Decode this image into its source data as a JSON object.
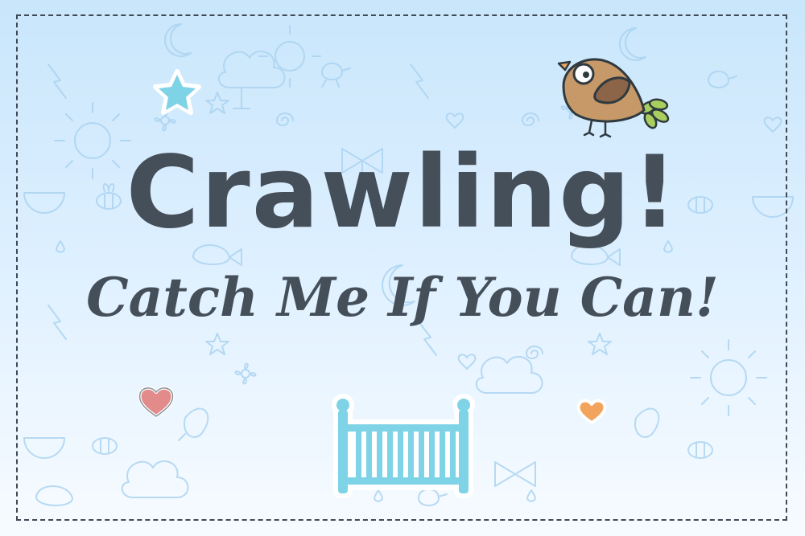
{
  "card": {
    "title": "Crawling!",
    "subtitle": "Catch Me If You Can!"
  },
  "colors": {
    "text": "#454f59",
    "background_top": "#c9e6fb",
    "background_bottom": "#f7fbff",
    "doodle_line": "#a9d2f0",
    "frame_dash": "#3f4a55",
    "crib": "#7fd3e6",
    "star": "#7fd3e6",
    "heart_pink": "#e38a8a",
    "heart_orange": "#f2a45c",
    "bird_body": "#c79868",
    "bird_wing": "#8c6448",
    "bird_tail": "#a8cf5e"
  },
  "decorations": [
    "bird-sticker",
    "star-sticker",
    "pink-heart-sticker",
    "orange-heart-sticker",
    "crib-sticker"
  ]
}
